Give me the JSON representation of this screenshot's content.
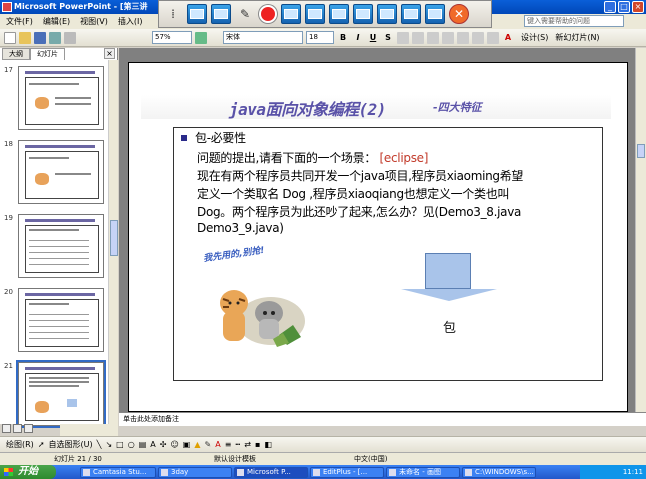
{
  "window": {
    "title": "Microsoft PowerPoint - [第三讲",
    "min": "_",
    "max": "□",
    "close": "×"
  },
  "menu": [
    "文件(F)",
    "编辑(E)",
    "视图(V)",
    "插入(I)"
  ],
  "help_placeholder": "键入需要帮助的问题",
  "toolbar": {
    "zoom": "57%",
    "font": "宋体",
    "font_size": "18",
    "bold": "B",
    "italic": "I",
    "underline": "U",
    "design": "设计(S)",
    "new_slide": "新幻灯片(N)"
  },
  "pane": {
    "tab_outline": "大纲",
    "tab_slides": "幻灯片",
    "close": "×",
    "slides": [
      {
        "num": "17"
      },
      {
        "num": "18"
      },
      {
        "num": "19"
      },
      {
        "num": "20"
      },
      {
        "num": "21"
      }
    ]
  },
  "slide": {
    "title": "java面向对象编程(2)",
    "subtitle": "-四大特征",
    "bullet_heading": "包-必要性",
    "line1_a": "问题的提出,请看下面的一个场景：",
    "line1_b": "[eclipse]",
    "line2": "现在有两个程序员共同开发一个java项目,程序员xiaoming希望",
    "line3": "定义一个类取名 Dog ,程序员xiaoqiang也想定义一个类也叫",
    "line4": "Dog。两个程序员为此还吵了起来,怎么办？见(Demo3_8.java",
    "line5": "Demo3_9.java)",
    "art_caption": "我先用的,别抢!",
    "arrow_label": "包"
  },
  "notes_placeholder": "单击此处添加备注",
  "drawbar": {
    "draw": "绘图(R)",
    "autoshape": "自选图形(U)"
  },
  "status": {
    "slide_count": "幻灯片 21 / 30",
    "template": "默认设计模板",
    "language": "中文(中国)"
  },
  "taskbar": {
    "start": "开始",
    "tasks": [
      "Camtasia Stu...",
      "3day",
      "Microsoft P...",
      "EditPlus - [...",
      "未命名 - 画图",
      "C:\\WINDOWS\\s..."
    ],
    "time": "11:11"
  },
  "colors": {
    "title_accent": "#5a52a8",
    "eclipse_accent": "#c23a2a",
    "arrow_fill": "#a9c4ea"
  }
}
